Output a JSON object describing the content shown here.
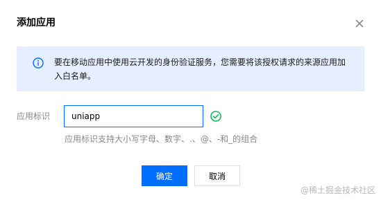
{
  "dialog": {
    "title": "添加应用",
    "close_icon": "close-icon"
  },
  "notice": {
    "icon": "info-icon",
    "text": "要在移动应用中使用云开发的身份验证服务，您需要将该授权请求的来源应用加入白名单。",
    "background": "#e5efff",
    "icon_color": "#006eff"
  },
  "form": {
    "label": "应用标识",
    "input_value": "uniapp",
    "valid_icon": "check-circle-icon",
    "valid_color": "#0abf5b",
    "hint": "应用标识支持大小写字母、数字、.、@、-和_的组合"
  },
  "buttons": {
    "confirm_label": "确定",
    "cancel_label": "取消",
    "primary_color": "#006eff"
  },
  "watermark": "@稀土掘金技术社区"
}
